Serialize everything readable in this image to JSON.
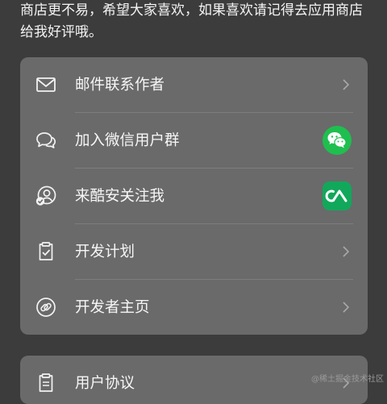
{
  "intro": {
    "line1": "商店更不易，希望大家喜欢，如果喜欢请记得去应用商店",
    "line2": "给我好评哦。"
  },
  "menu": {
    "items": [
      {
        "label": "邮件联系作者",
        "icon": "mail-icon",
        "trailing": "chevron-right-icon"
      },
      {
        "label": "加入微信用户群",
        "icon": "chat-bubbles-icon",
        "trailing": "wechat-icon"
      },
      {
        "label": "来酷安关注我",
        "icon": "user-follow-icon",
        "trailing": "coolapk-icon"
      },
      {
        "label": "开发计划",
        "icon": "clipboard-check-icon",
        "trailing": "chevron-right-icon"
      },
      {
        "label": "开发者主页",
        "icon": "link-icon",
        "trailing": "chevron-right-icon"
      }
    ]
  },
  "second_menu": {
    "items": [
      {
        "label": "用户协议",
        "icon": "document-icon",
        "trailing": "chevron-right-icon"
      }
    ]
  },
  "watermark": "@稀土掘金技术社区",
  "colors": {
    "background": "#3c3c3c",
    "card": "#6a6a6a",
    "wechat": "#1fbf4f",
    "coolapk": "#11a85b"
  }
}
